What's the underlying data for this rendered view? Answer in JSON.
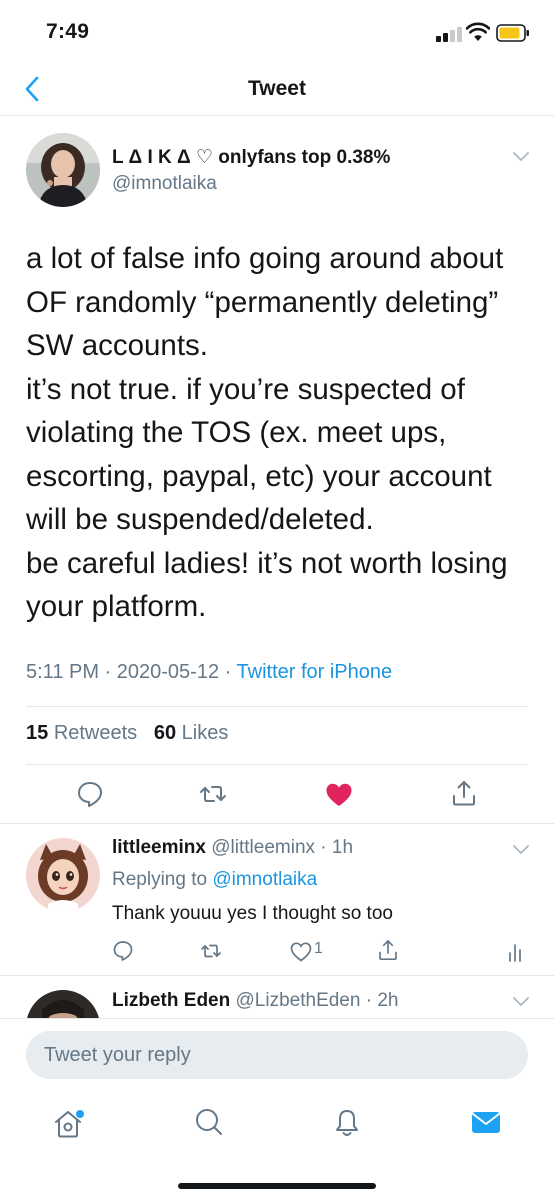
{
  "status_bar": {
    "time": "7:49"
  },
  "nav": {
    "title": "Tweet"
  },
  "tweet": {
    "author_name": "L Δ I K Δ ♡ onlyfans top 0.38%",
    "author_handle": "@imnotlaika",
    "text_lines": [
      "a lot of false info going around about",
      "OF randomly “permanently deleting”",
      "SW accounts.",
      "it’s not true. if you’re suspected of",
      "violating the TOS (ex. meet ups,",
      "escorting, paypal, etc) your account",
      "will be suspended/deleted.",
      "be careful ladies! it’s not worth losing",
      "your platform."
    ],
    "time": "5:11 PM",
    "date": "2020-05-12",
    "source": "Twitter for iPhone",
    "retweets_count": "15",
    "retweets_label": "Retweets",
    "likes_count": "60",
    "likes_label": "Likes",
    "liked": true
  },
  "replies": [
    {
      "name": "littleeminx",
      "handle": "@littleeminx",
      "age": "1h",
      "replying_label": "Replying to",
      "replying_handle": "@imnotlaika",
      "text": "Thank youuu yes I thought so too",
      "likes": "1"
    },
    {
      "name": "Lizbeth Eden",
      "handle": "@LizbethEden",
      "age": "2h"
    }
  ],
  "compose": {
    "placeholder": "Tweet your reply"
  },
  "tab_bar": {
    "tabs": [
      "home-icon",
      "search-icon",
      "notifications-icon",
      "messages-icon"
    ],
    "has_home_notification": true
  },
  "colors": {
    "accent": "#1da1f2",
    "like": "#e0245e",
    "secondary_text": "#657786",
    "primary_text": "#14171a",
    "divider": "#e1e8ed",
    "compose_bg": "#e6ecf0"
  }
}
